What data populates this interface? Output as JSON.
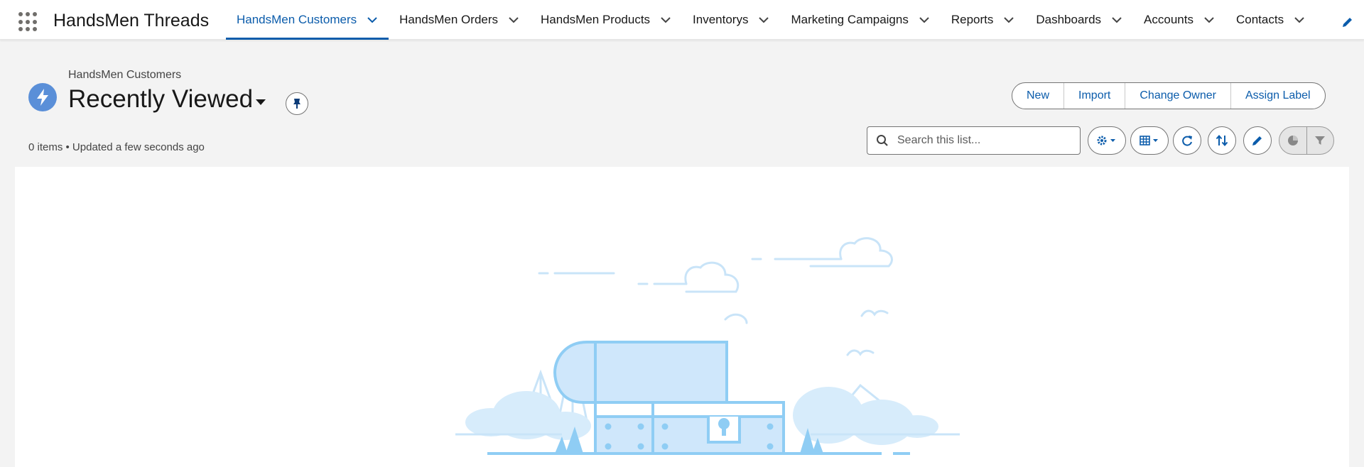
{
  "app": {
    "name": "HandsMen Threads"
  },
  "nav": {
    "tabs": [
      {
        "label": "HandsMen Customers",
        "active": true
      },
      {
        "label": "HandsMen Orders",
        "active": false
      },
      {
        "label": "HandsMen Products",
        "active": false
      },
      {
        "label": "Inventorys",
        "active": false
      },
      {
        "label": "Marketing Campaigns",
        "active": false
      },
      {
        "label": "Reports",
        "active": false
      },
      {
        "label": "Dashboards",
        "active": false
      },
      {
        "label": "Accounts",
        "active": false
      },
      {
        "label": "Contacts",
        "active": false
      }
    ]
  },
  "header": {
    "breadcrumb": "HandsMen Customers",
    "title": "Recently Viewed",
    "meta": "0 items • Updated a few seconds ago"
  },
  "actions": {
    "new": "New",
    "import": "Import",
    "change_owner": "Change Owner",
    "assign_label": "Assign Label"
  },
  "search": {
    "placeholder": "Search this list..."
  },
  "icons": {
    "app_launcher": "waffle-icon",
    "object": "lightning-icon",
    "pin": "pin-icon",
    "search": "search-icon",
    "settings": "gear-icon",
    "display": "table-icon",
    "refresh": "refresh-icon",
    "sort": "sort-icon",
    "edit": "pencil-icon",
    "chart": "pie-chart-icon",
    "filter": "filter-icon"
  },
  "colors": {
    "brand": "#0b5cab",
    "object_icon": "#5a8fd8",
    "illustration": "#8fcdf4"
  }
}
